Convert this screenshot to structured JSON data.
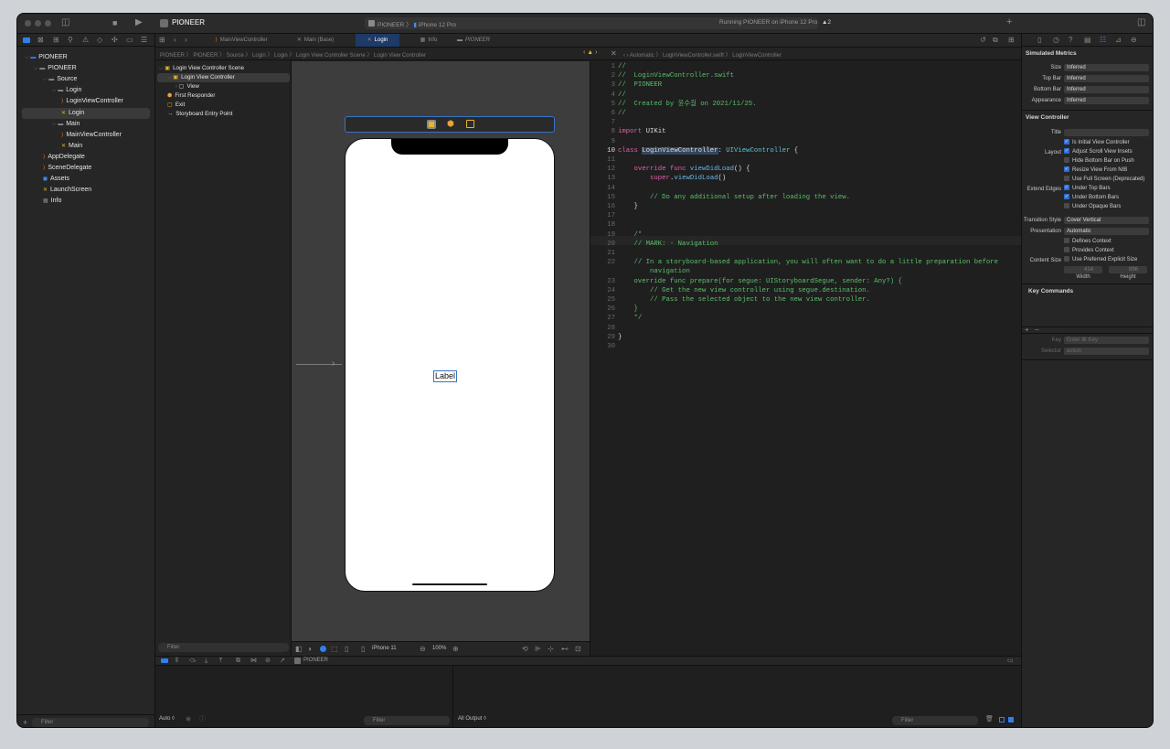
{
  "window": {
    "project": "PIONEER",
    "scheme_project": "PIONEER",
    "device": "iPhone 12 Pro",
    "status": "Running PIONEER on iPhone 12 Pro",
    "warnings": "▲2"
  },
  "tabs": [
    {
      "label": "MainViewController"
    },
    {
      "label": "Main (Base)"
    },
    {
      "label": "Login"
    },
    {
      "label": "Info"
    },
    {
      "label": "PIONEER"
    }
  ],
  "jumpbar": {
    "left": "PIONEER 〉 PIONEER 〉 Source 〉 Login 〉 Login 〉 Login View Controller Scene 〉 Login View Controller",
    "right": "Automatic 〉 LoginViewController.swift 〉 LoginViewController"
  },
  "navigator": {
    "items": [
      {
        "label": "PIONEER",
        "indent": 0,
        "kind": "project"
      },
      {
        "label": "PIONEER",
        "indent": 1,
        "kind": "folder"
      },
      {
        "label": "Source",
        "indent": 2,
        "kind": "folder"
      },
      {
        "label": "Login",
        "indent": 3,
        "kind": "folder"
      },
      {
        "label": "LoginViewController",
        "indent": 4,
        "kind": "swift"
      },
      {
        "label": "Login",
        "indent": 4,
        "kind": "storyboard"
      },
      {
        "label": "Main",
        "indent": 3,
        "kind": "folder"
      },
      {
        "label": "MainViewController",
        "indent": 4,
        "kind": "swift"
      },
      {
        "label": "Main",
        "indent": 4,
        "kind": "storyboard"
      },
      {
        "label": "AppDelegate",
        "indent": 2,
        "kind": "swift"
      },
      {
        "label": "SceneDelegate",
        "indent": 2,
        "kind": "swift"
      },
      {
        "label": "Assets",
        "indent": 2,
        "kind": "assets"
      },
      {
        "label": "LaunchScreen",
        "indent": 2,
        "kind": "storyboard"
      },
      {
        "label": "Info",
        "indent": 2,
        "kind": "plist"
      }
    ],
    "filter": "Filter"
  },
  "outline": {
    "items": [
      {
        "label": "Login View Controller Scene",
        "indent": 0
      },
      {
        "label": "Login View Controller",
        "indent": 1
      },
      {
        "label": "View",
        "indent": 2
      },
      {
        "label": "First Responder",
        "indent": 1
      },
      {
        "label": "Exit",
        "indent": 1
      },
      {
        "label": "Storyboard Entry Point",
        "indent": 1
      }
    ],
    "filter": "Filter"
  },
  "canvas": {
    "label": "Label",
    "device": "iPhone 11",
    "zoom": "100%"
  },
  "code": [
    "//",
    "//  LoginViewController.swift",
    "//  PIONEER",
    "//",
    "//  Created by 윤수길 on 2021/11/25.",
    "//",
    "",
    "import UIKit",
    "",
    "class LoginViewController: UIViewController {",
    "",
    "    override func viewDidLoad() {",
    "        super.viewDidLoad()",
    "",
    "        // Do any additional setup after loading the view.",
    "    }",
    "",
    "",
    "    /*",
    "    // MARK: - Navigation",
    "",
    "    // In a storyboard-based application, you will often want to do a little preparation before",
    "        navigation",
    "    override func prepare(for segue: UIStoryboardSegue, sender: Any?) {",
    "        // Get the new view controller using segue.destination.",
    "        // Pass the selected object to the new view controller.",
    "    }",
    "    */",
    "",
    "}",
    ""
  ],
  "line_numbers": [
    "1",
    "2",
    "3",
    "4",
    "5",
    "6",
    "7",
    "8",
    "9",
    "10",
    "11",
    "12",
    "13",
    "14",
    "15",
    "16",
    "17",
    "18",
    "19",
    "20",
    "21",
    "22",
    "",
    "23",
    "24",
    "25",
    "26",
    "27",
    "28",
    "29",
    "30"
  ],
  "inspector": {
    "sim_title": "Simulated Metrics",
    "size": {
      "label": "Size",
      "value": "Inferred"
    },
    "topbar": {
      "label": "Top Bar",
      "value": "Inferred"
    },
    "bottombar": {
      "label": "Bottom Bar",
      "value": "Inferred"
    },
    "appearance": {
      "label": "Appearance",
      "value": "Inferred"
    },
    "vc_title": "View Controller",
    "title_label": "Title",
    "initial": "Is Initial View Controller",
    "layout_label": "Layout",
    "layout": [
      {
        "label": "Adjust Scroll View Insets",
        "on": true
      },
      {
        "label": "Hide Bottom Bar on Push",
        "on": false
      },
      {
        "label": "Resize View From NIB",
        "on": true
      },
      {
        "label": "Use Full Screen (Deprecated)",
        "on": false
      }
    ],
    "edges_label": "Extend Edges",
    "edges": [
      {
        "label": "Under Top Bars",
        "on": true
      },
      {
        "label": "Under Bottom Bars",
        "on": true
      },
      {
        "label": "Under Opaque Bars",
        "on": false
      }
    ],
    "transition": {
      "label": "Transition Style",
      "value": "Cover Vertical"
    },
    "presentation": {
      "label": "Presentation",
      "value": "Automatic"
    },
    "defines": "Defines Context",
    "provides": "Provides Context",
    "content_label": "Content Size",
    "preferred": "Use Preferred Explicit Size",
    "width_val": "414",
    "height_val": "896",
    "width_label": "Width",
    "height_label": "Height",
    "key_title": "Key Commands",
    "key_label": "Key",
    "key_placeholder": "Enter ⌘ Key",
    "selector_label": "Selector",
    "selector_placeholder": "action"
  },
  "debug": {
    "auto": "Auto ◊",
    "filter1": "Filter",
    "output": "All Output ◊",
    "filter2": "Filter",
    "target": "PIONEER"
  }
}
